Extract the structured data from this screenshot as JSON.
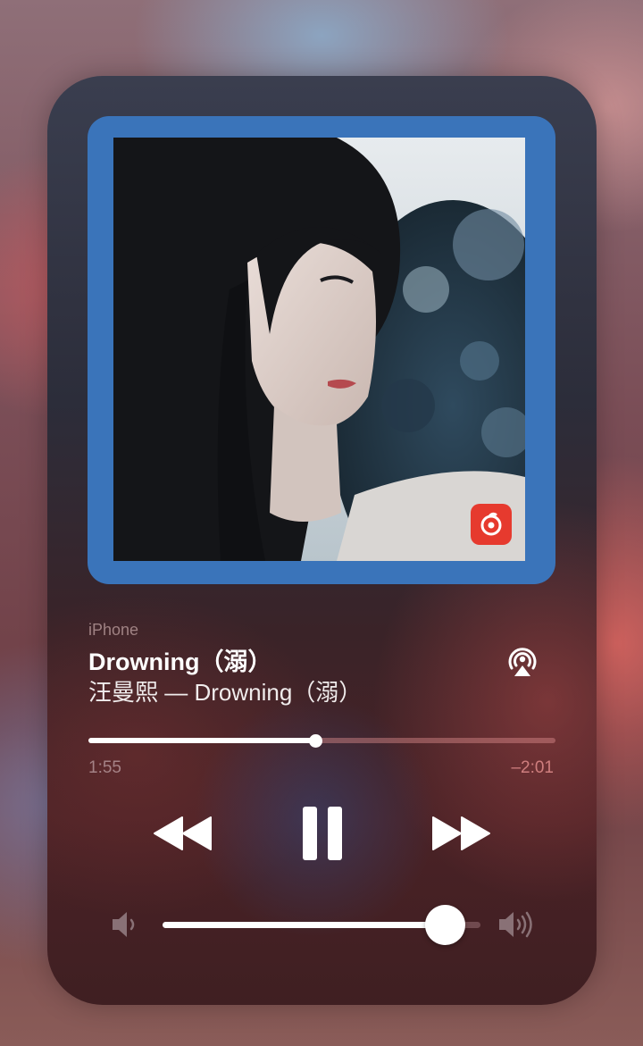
{
  "player": {
    "source_device": "iPhone",
    "track_title": "Drowning（溺）",
    "track_subtitle": "汪曼熙 — Drowning（溺）",
    "elapsed": "1:55",
    "remaining": "–2:01",
    "progress_fraction": 0.487,
    "volume_fraction": 0.89,
    "state": "playing"
  },
  "icons": {
    "app_badge": "netease-cloud-music-icon",
    "airplay": "airplay-icon",
    "rewind": "rewind-icon",
    "pause": "pause-icon",
    "forward": "fast-forward-icon",
    "volume_low": "speaker-low-icon",
    "volume_high": "speaker-high-icon"
  },
  "colors": {
    "artwork_frame": "#3a74ba",
    "app_badge": "#e63a2e",
    "remaining_time": "#e08c8c"
  }
}
